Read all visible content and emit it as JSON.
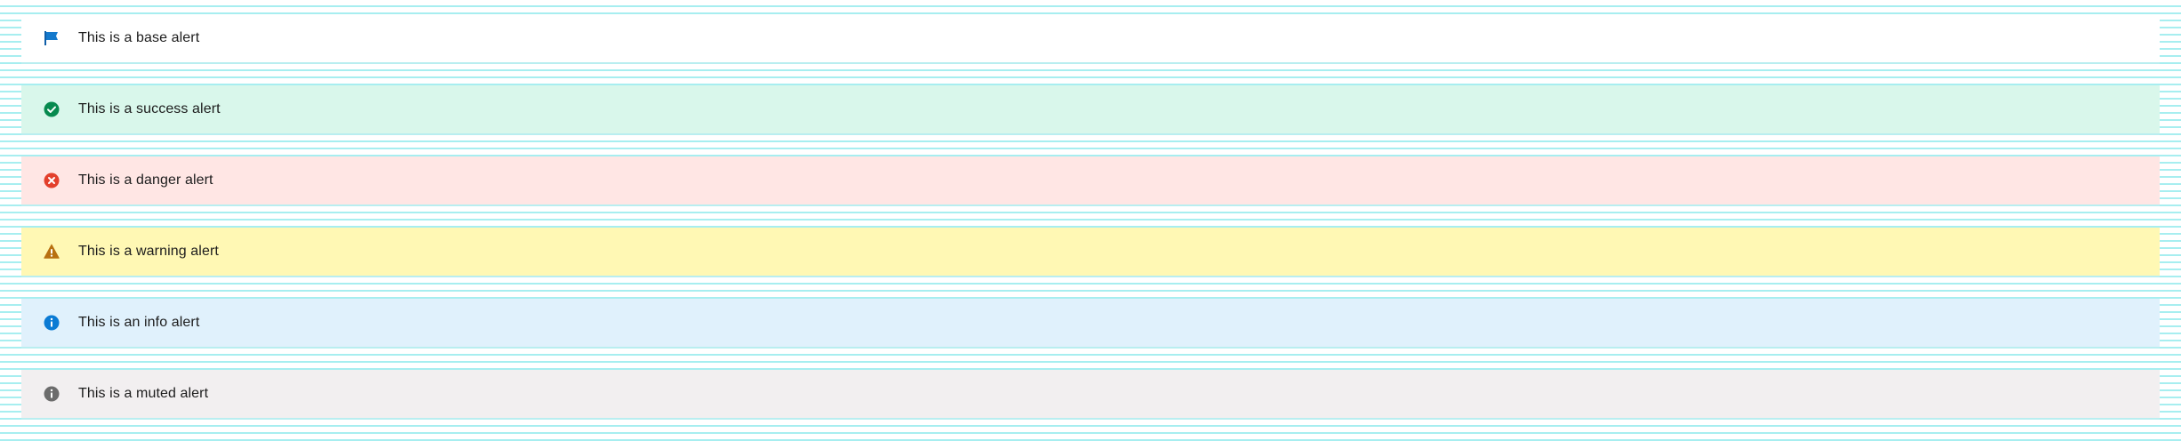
{
  "alerts": [
    {
      "variant": "base",
      "icon": "flag-icon",
      "icon_color": "#1479cc",
      "background": "#ffffff",
      "text": "This is a base alert"
    },
    {
      "variant": "success",
      "icon": "check-circle-icon",
      "icon_color": "#078a4f",
      "background": "#d9f7eb",
      "text": "This is a success alert"
    },
    {
      "variant": "danger",
      "icon": "error-circle-icon",
      "icon_color": "#e3402c",
      "background": "#ffe6e4",
      "text": "This is a danger alert"
    },
    {
      "variant": "warning",
      "icon": "warning-triangle-icon",
      "icon_color": "#b87010",
      "background": "#fff8b4",
      "text": "This is a warning alert"
    },
    {
      "variant": "info",
      "icon": "info-circle-icon",
      "icon_color": "#0b7bd4",
      "background": "#e0f1fc",
      "text": "This is an info alert"
    },
    {
      "variant": "muted",
      "icon": "info-circle-icon",
      "icon_color": "#6c6c6c",
      "background": "#f2eff0",
      "text": "This is a muted alert"
    }
  ]
}
